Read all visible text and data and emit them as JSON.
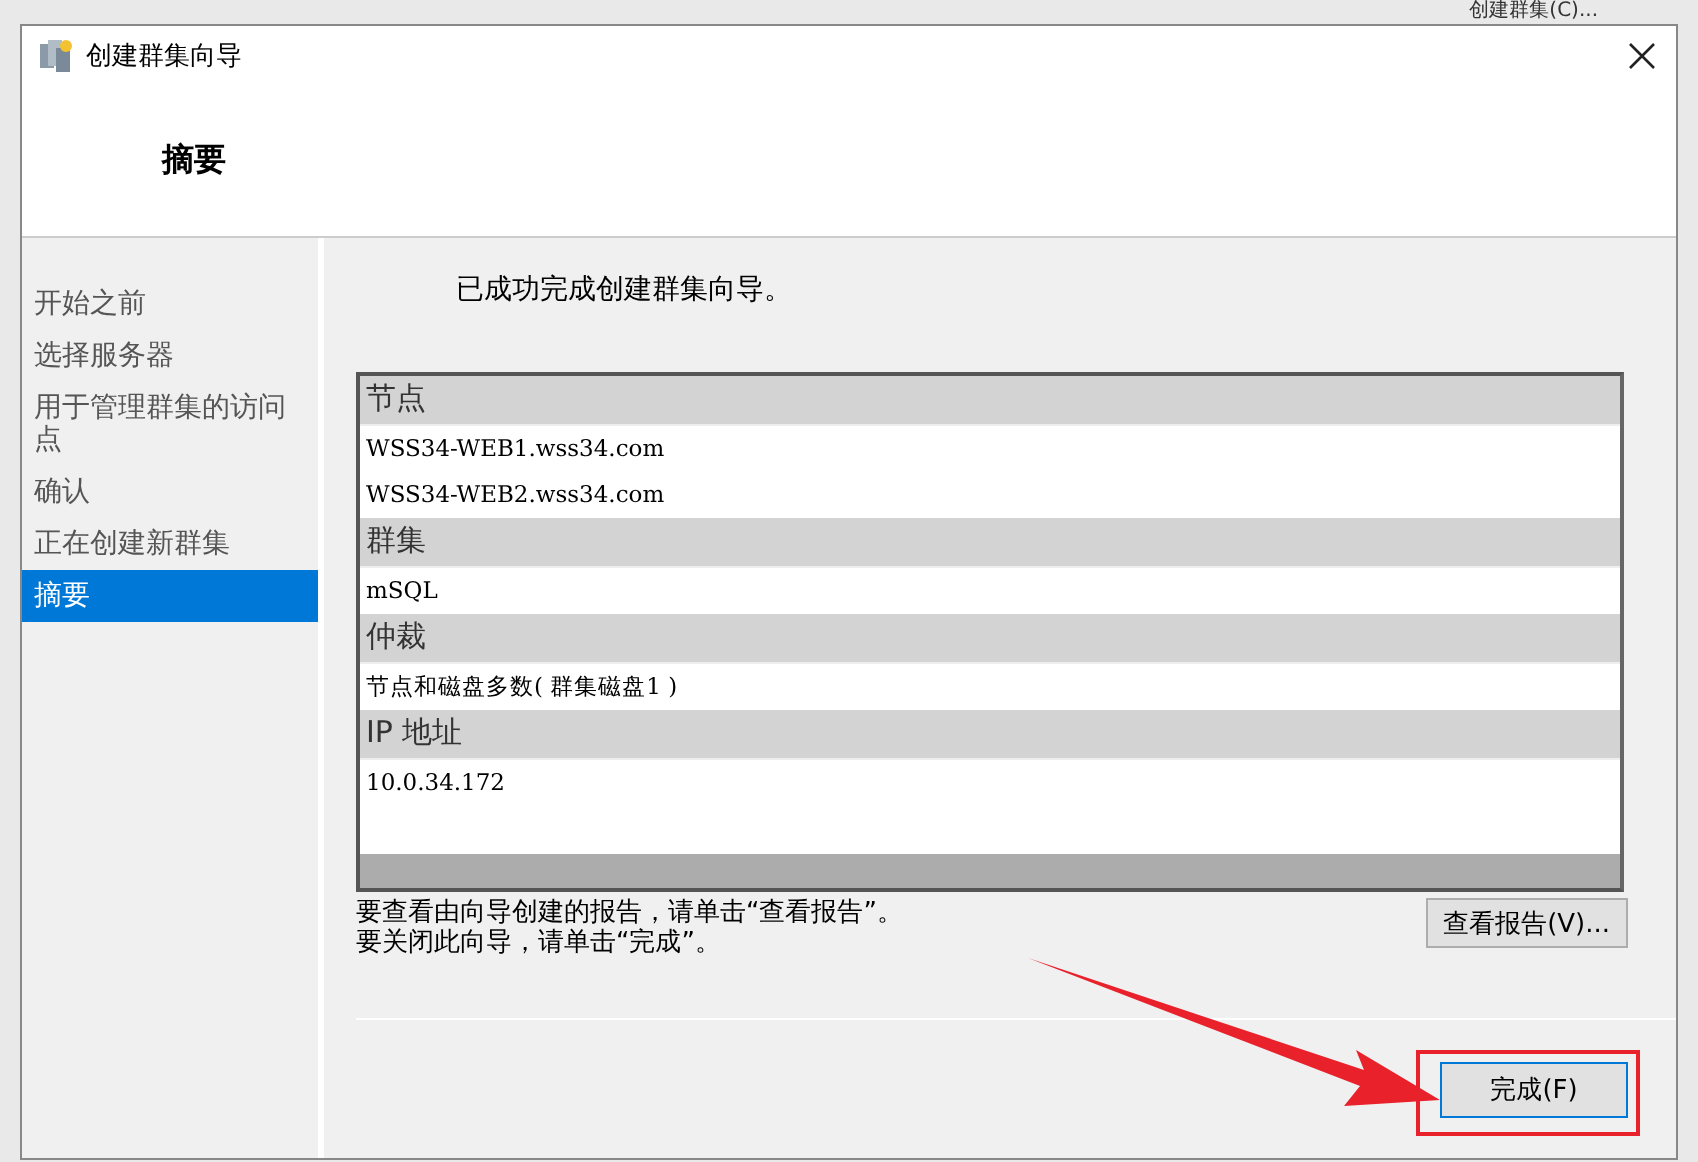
{
  "background_window": {
    "action": "创建群集(C)..."
  },
  "window": {
    "title": "创建群集向导",
    "heading": "摘要"
  },
  "steps": [
    {
      "label": "开始之前",
      "selected": false
    },
    {
      "label": "选择服务器",
      "selected": false
    },
    {
      "label": "用于管理群集的访问点",
      "selected": false
    },
    {
      "label": "确认",
      "selected": false
    },
    {
      "label": "正在创建新群集",
      "selected": false
    },
    {
      "label": "摘要",
      "selected": true
    }
  ],
  "message": "已成功完成创建群集向导。",
  "summary": [
    {
      "heading": "节点",
      "values": [
        "WSS34-WEB1.wss34.com",
        "WSS34-WEB2.wss34.com"
      ]
    },
    {
      "heading": "群集",
      "values": [
        "mSQL"
      ]
    },
    {
      "heading": "仲裁",
      "values": [
        "节点和磁盘多数( 群集磁盘1 )"
      ]
    },
    {
      "heading": "IP 地址",
      "values": [
        "10.0.34.172"
      ]
    }
  ],
  "hints": [
    "要查看由向导创建的报告，请单击“查看报告”。",
    "要关闭此向导，请单击“完成”。"
  ],
  "buttons": {
    "report": "查看报告(V)...",
    "finish": "完成(F)"
  }
}
